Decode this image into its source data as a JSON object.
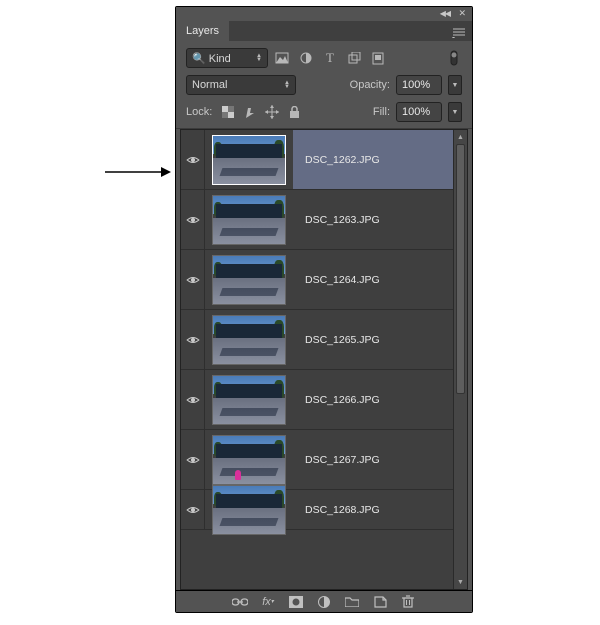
{
  "panel": {
    "title": "Layers",
    "filter": {
      "kind_label": "Kind",
      "kind_value": "Kind"
    },
    "blend": {
      "mode": "Normal",
      "opacity_label": "Opacity:",
      "opacity_value": "100%",
      "lock_label": "Lock:",
      "fill_label": "Fill:",
      "fill_value": "100%"
    },
    "layers": [
      {
        "name": "DSC_1262.JPG",
        "visible": true,
        "selected": true,
        "has_person": false
      },
      {
        "name": "DSC_1263.JPG",
        "visible": true,
        "selected": false,
        "has_person": false
      },
      {
        "name": "DSC_1264.JPG",
        "visible": true,
        "selected": false,
        "has_person": false
      },
      {
        "name": "DSC_1265.JPG",
        "visible": true,
        "selected": false,
        "has_person": false
      },
      {
        "name": "DSC_1266.JPG",
        "visible": true,
        "selected": false,
        "has_person": false
      },
      {
        "name": "DSC_1267.JPG",
        "visible": true,
        "selected": false,
        "has_person": true
      },
      {
        "name": "DSC_1268.JPG",
        "visible": true,
        "selected": false,
        "has_person": false
      }
    ]
  }
}
